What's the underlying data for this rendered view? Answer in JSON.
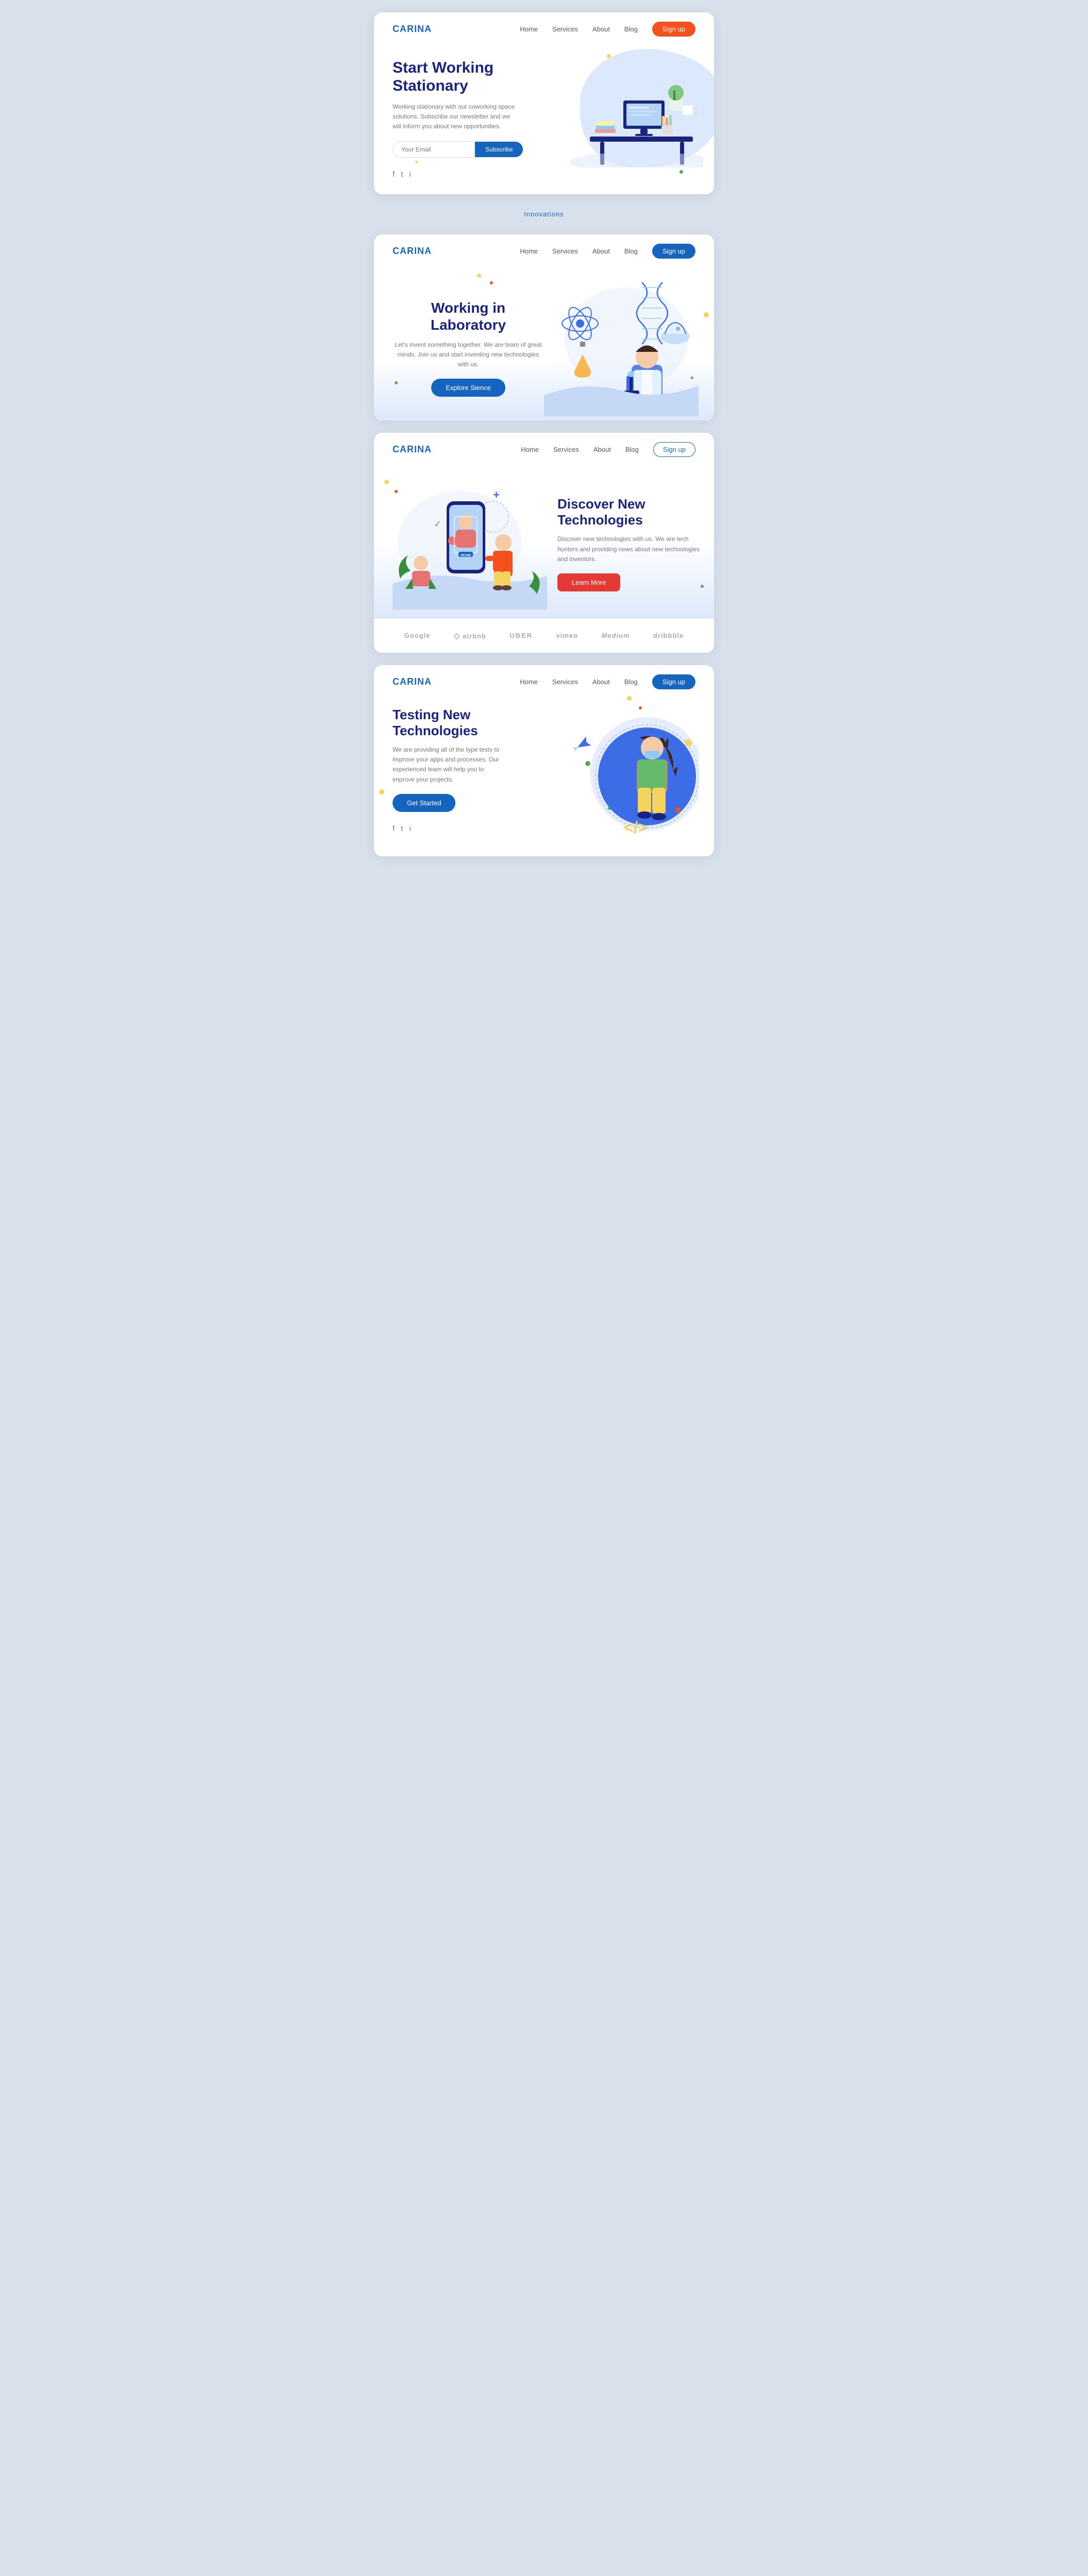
{
  "sections": [
    {
      "id": "section1",
      "logo": "CARINA",
      "nav": {
        "links": [
          "Home",
          "Services",
          "About",
          "Blog"
        ],
        "signup": "Sign up",
        "signupColor": "orange"
      },
      "title": "Start Working Stationary",
      "description": "Working stationary with our coworking space solutions. Subscribe our newsletter and we will inform you about new opportunities.",
      "input_placeholder": "Your Email",
      "subscribe_label": "Subscribe",
      "social_icons": [
        "facebook",
        "twitter",
        "instagram"
      ]
    },
    {
      "id": "innovations",
      "label": "Innovations"
    },
    {
      "id": "section2",
      "logo": "CARINA",
      "nav": {
        "links": [
          "Home",
          "Services",
          "About",
          "Blog"
        ],
        "signup": "Sign up",
        "signupColor": "green"
      },
      "title": "Working in Laboratory",
      "description": "Let's invent something together. We are team of great minds. Join us and start inventing new technologies with us.",
      "button_label": "Explore Sience"
    },
    {
      "id": "section3",
      "logo": "CARINA",
      "nav": {
        "links": [
          "Home",
          "Services",
          "About",
          "Blog"
        ],
        "signup": "Sign up",
        "signupColor": "blue-outline"
      },
      "title": "Discover New Technologies",
      "description": "Discover new technologies with us. We are tech hunters and providing news about new technologies and inventors.",
      "button_label": "Learn More",
      "brands": [
        "Google",
        "airbnb",
        "UBER",
        "vimeo",
        "Medium",
        "dribbble"
      ]
    },
    {
      "id": "section4",
      "logo": "CARINA",
      "nav": {
        "links": [
          "Home",
          "Services",
          "About",
          "Blog"
        ],
        "signup": "Sign up",
        "signupColor": "green"
      },
      "title": "Testing New Technologies",
      "description": "We are providing all of the type tests to improve your apps and processes. Our experienced team will help you to improve your projects.",
      "button_label": "Get Started",
      "social_icons": [
        "facebook",
        "twitter",
        "instagram"
      ]
    }
  ]
}
